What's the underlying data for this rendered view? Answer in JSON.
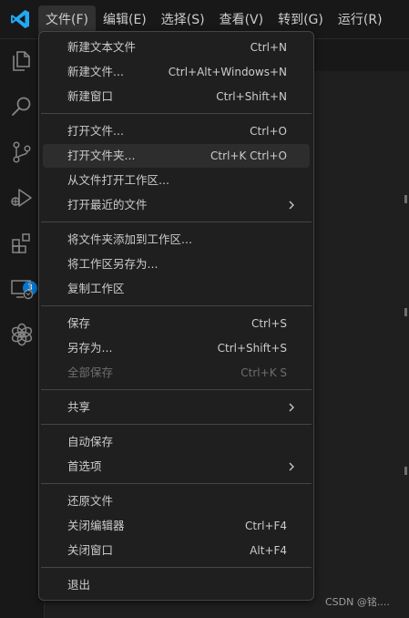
{
  "menubar": {
    "items": [
      "文件(F)",
      "编辑(E)",
      "选择(S)",
      "查看(V)",
      "转到(G)",
      "运行(R)"
    ],
    "active_index": 0
  },
  "activity_bar": {
    "icons": [
      "explorer-icon",
      "search-icon",
      "source-control-icon",
      "run-debug-icon",
      "extensions-icon",
      "remote-explorer-icon",
      "chatgpt-icon"
    ],
    "extensions_badge": "3"
  },
  "file_menu": {
    "groups": [
      [
        {
          "label": "新建文本文件",
          "shortcut": "Ctrl+N"
        },
        {
          "label": "新建文件...",
          "shortcut": "Ctrl+Alt+Windows+N"
        },
        {
          "label": "新建窗口",
          "shortcut": "Ctrl+Shift+N"
        }
      ],
      [
        {
          "label": "打开文件...",
          "shortcut": "Ctrl+O"
        },
        {
          "label": "打开文件夹...",
          "shortcut": "Ctrl+K Ctrl+O",
          "highlighted": true
        },
        {
          "label": "从文件打开工作区..."
        },
        {
          "label": "打开最近的文件",
          "submenu": true
        }
      ],
      [
        {
          "label": "将文件夹添加到工作区..."
        },
        {
          "label": "将工作区另存为..."
        },
        {
          "label": "复制工作区"
        }
      ],
      [
        {
          "label": "保存",
          "shortcut": "Ctrl+S"
        },
        {
          "label": "另存为...",
          "shortcut": "Ctrl+Shift+S"
        },
        {
          "label": "全部保存",
          "shortcut": "Ctrl+K S",
          "disabled": true
        }
      ],
      [
        {
          "label": "共享",
          "submenu": true
        }
      ],
      [
        {
          "label": "自动保存"
        },
        {
          "label": "首选项",
          "submenu": true
        }
      ],
      [
        {
          "label": "还原文件"
        },
        {
          "label": "关闭编辑器",
          "shortcut": "Ctrl+F4"
        },
        {
          "label": "关闭窗口",
          "shortcut": "Alt+F4"
        }
      ],
      [
        {
          "label": "退出"
        }
      ]
    ]
  },
  "watermark": "CSDN @铭....",
  "colors": {
    "accent": "#0078d4",
    "logo": "#23a9f2",
    "menu_bg": "#1f1f1f",
    "highlight": "#2d2d2d"
  }
}
